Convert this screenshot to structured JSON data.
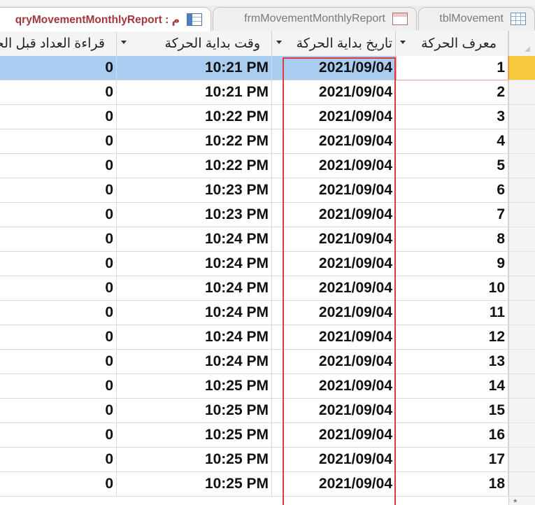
{
  "tabs": [
    {
      "label": "qryMovementMonthlyReport : م",
      "icon": "query-icon",
      "active": true
    },
    {
      "label": "frmMovementMonthlyReport",
      "icon": "form-icon",
      "active": false
    },
    {
      "label": "tblMovement",
      "icon": "table-icon",
      "active": false
    }
  ],
  "columns": {
    "id": "معرف الحركة",
    "start_date": "تاريخ بداية الحركة",
    "start_time": "وقت بداية الحركة",
    "reading": "قراءة العداد قبل الحركة"
  },
  "rows": [
    {
      "id": "1",
      "date": "2021/09/04",
      "time": "10:21 PM",
      "reading": "0"
    },
    {
      "id": "2",
      "date": "2021/09/04",
      "time": "10:21 PM",
      "reading": "0"
    },
    {
      "id": "3",
      "date": "2021/09/04",
      "time": "10:22 PM",
      "reading": "0"
    },
    {
      "id": "4",
      "date": "2021/09/04",
      "time": "10:22 PM",
      "reading": "0"
    },
    {
      "id": "5",
      "date": "2021/09/04",
      "time": "10:22 PM",
      "reading": "0"
    },
    {
      "id": "6",
      "date": "2021/09/04",
      "time": "10:23 PM",
      "reading": "0"
    },
    {
      "id": "7",
      "date": "2021/09/04",
      "time": "10:23 PM",
      "reading": "0"
    },
    {
      "id": "8",
      "date": "2021/09/04",
      "time": "10:24 PM",
      "reading": "0"
    },
    {
      "id": "9",
      "date": "2021/09/04",
      "time": "10:24 PM",
      "reading": "0"
    },
    {
      "id": "10",
      "date": "2021/09/04",
      "time": "10:24 PM",
      "reading": "0"
    },
    {
      "id": "11",
      "date": "2021/09/04",
      "time": "10:24 PM",
      "reading": "0"
    },
    {
      "id": "12",
      "date": "2021/09/04",
      "time": "10:24 PM",
      "reading": "0"
    },
    {
      "id": "13",
      "date": "2021/09/04",
      "time": "10:24 PM",
      "reading": "0"
    },
    {
      "id": "14",
      "date": "2021/09/04",
      "time": "10:25 PM",
      "reading": "0"
    },
    {
      "id": "15",
      "date": "2021/09/04",
      "time": "10:25 PM",
      "reading": "0"
    },
    {
      "id": "16",
      "date": "2021/09/04",
      "time": "10:25 PM",
      "reading": "0"
    },
    {
      "id": "17",
      "date": "2021/09/04",
      "time": "10:25 PM",
      "reading": "0"
    },
    {
      "id": "18",
      "date": "2021/09/04",
      "time": "10:25 PM",
      "reading": "0"
    }
  ],
  "selected_row": "1",
  "new_record_marker": "*",
  "colors": {
    "selected_row": "#a9cdf0",
    "record_selector_active": "#f7c93d",
    "highlight_box": "#e0393e",
    "active_tab_text": "#a4373a"
  }
}
